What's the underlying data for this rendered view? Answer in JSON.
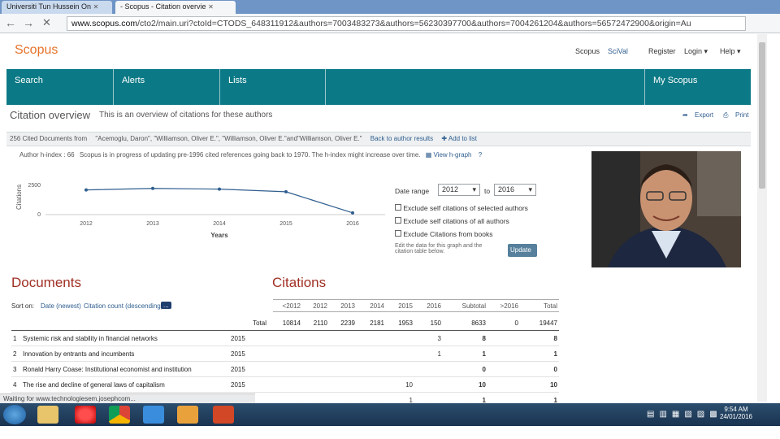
{
  "browser": {
    "tabs": [
      {
        "label": "Universiti Tun Hussein On"
      },
      {
        "label": "- Scopus - Citation overvie"
      }
    ],
    "url_domain": "www.scopus.com",
    "url_rest": "/cto2/main.uri?ctoId=CTODS_648311912&authors=7003483273&authors=56230397700&authors=7004261204&authors=56572472900&origin=Au"
  },
  "header": {
    "logo": "Scopus",
    "links": [
      "Scopus",
      "SciVal",
      "Register",
      "Login ▾",
      "Help ▾"
    ]
  },
  "nav": {
    "items": [
      "Search",
      "Alerts",
      "Lists",
      "My Scopus"
    ]
  },
  "overview": {
    "title": "Citation overview",
    "subtitle": "This is an overview of citations for these authors",
    "export": "Export",
    "print": "Print",
    "docs_count": "256 Cited Documents from",
    "docs_authors": "\"Acemoglu, Daron\", \"Williamson, Oliver E.\", \"Williamson, Oliver E.\"and\"Williamson, Oliver E.\"",
    "back_link": "Back to author results",
    "add_list": "Add to list",
    "hindex_label": "Author h-index : 66",
    "hindex_note": "Scopus is in progress of updating pre-1996 cited references going back to 1970. The h-index might increase over time.",
    "hgraph_link": "View h-graph"
  },
  "chart_data": {
    "type": "line",
    "x": [
      2012,
      2013,
      2014,
      2015,
      2016
    ],
    "values": [
      2110,
      2239,
      2181,
      1953,
      150
    ],
    "ylabel": "Citations",
    "xlabel": "Years",
    "yticks": [
      "2500",
      "0"
    ],
    "ylim": [
      0,
      2500
    ],
    "color": "#2f5e8e"
  },
  "date_panel": {
    "label": "Date range",
    "from": "2012",
    "to_label": "to",
    "to": "2016",
    "options": [
      "Exclude self citations of selected authors",
      "Exclude self citations of all authors",
      "Exclude Citations from books"
    ],
    "note": "Edit the data for this graph and the citation table below.",
    "update": "Update"
  },
  "table": {
    "documents_heading": "Documents",
    "citations_heading": "Citations",
    "sort_label": "Sort on:",
    "sort_date": "Date (newest)",
    "sort_cites": "Citation count (descending)",
    "more": "...",
    "headers": [
      "<2012",
      "2012",
      "2013",
      "2014",
      "2015",
      "2016",
      "Subtotal",
      ">2016",
      "Total"
    ],
    "total_label": "Total",
    "totals": [
      "10814",
      "2110",
      "2239",
      "2181",
      "1953",
      "150",
      "8633",
      "0",
      "19447"
    ],
    "rows": [
      {
        "num": "1",
        "title": "Systemic risk and stability in financial networks",
        "year": "2015",
        "c2016": "3",
        "subtotal": "8",
        "total": "8"
      },
      {
        "num": "2",
        "title": "Innovation by entrants and incumbents",
        "year": "2015",
        "c2016": "1",
        "subtotal": "1",
        "total": "1"
      },
      {
        "num": "3",
        "title": "Ronald Harry Coase: Institutional economist and institution",
        "year": "2015",
        "c2016": "",
        "subtotal": "0",
        "total": "0"
      },
      {
        "num": "4",
        "title": "The rise and decline of general laws of capitalism",
        "year": "2015",
        "c2015": "10",
        "subtotal": "10",
        "total": "10"
      },
      {
        "num": "",
        "title": "",
        "year": "",
        "c2015": "1",
        "subtotal": "1",
        "total": "1"
      }
    ]
  },
  "status": "Waiting for www.technologiesem.josephcom...",
  "clock": {
    "time": "9:54 AM",
    "date": "24/01/2016"
  }
}
